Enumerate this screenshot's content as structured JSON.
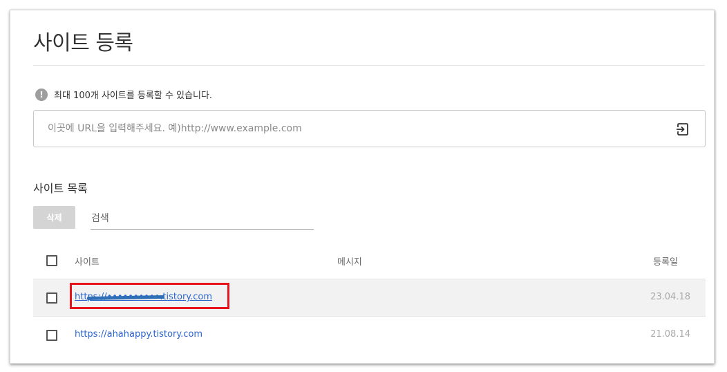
{
  "page": {
    "title": "사이트 등록",
    "notice": "최대 100개 사이트를 등록할 수 있습니다.",
    "notice_icon": "!",
    "url_input": {
      "placeholder": "이곳에 URL을 입력해주세요. 예)http://www.example.com",
      "value": ""
    },
    "submit_icon": "submit-arrow-icon"
  },
  "site_list": {
    "title": "사이트 목록",
    "delete_label": "삭제",
    "search_placeholder": "검색",
    "columns": {
      "site": "사이트",
      "message": "메시지",
      "date": "등록일"
    },
    "rows": [
      {
        "site": "https://••••••••••.tistory.com",
        "message": "",
        "date": "23.04.18",
        "redacted": true,
        "highlighted": true
      },
      {
        "site": "https://ahahappy.tistory.com",
        "message": "",
        "date": "21.08.14",
        "redacted": false,
        "highlighted": false
      }
    ]
  },
  "colors": {
    "link": "#2b66d0",
    "highlight_border": "#e8141b",
    "delete_bg": "#d4d4d4"
  }
}
